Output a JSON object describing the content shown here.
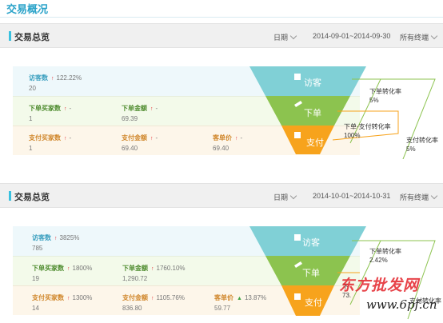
{
  "page_title": "交易概况",
  "panels": [
    {
      "title": "交易总览",
      "filters": {
        "date_label": "日期",
        "date_range": "2014-09-01~2014-09-30",
        "terminal": "所有终端"
      },
      "visitors": {
        "label": "访客数",
        "change": "122.22%",
        "value": "20"
      },
      "orders_buyers": {
        "label": "下单买家数",
        "change": "-",
        "value": "1"
      },
      "orders_amount": {
        "label": "下单金额",
        "change": "-",
        "value": "69.39"
      },
      "pay_buyers": {
        "label": "支付买家数",
        "change": "-",
        "value": "1"
      },
      "pay_amount": {
        "label": "支付金额",
        "change": "-",
        "value": "69.40"
      },
      "unit_price": {
        "label": "客单价",
        "change": "-",
        "value": "69.40"
      },
      "funnel": {
        "visit": "访客",
        "order": "下单",
        "pay": "支付"
      },
      "rates": {
        "order_conv_label": "下单转化率",
        "order_conv": "5%",
        "order_pay_label": "下单-支付转化率",
        "order_pay": "100%",
        "pay_conv_label": "支付转化率",
        "pay_conv": "5%"
      }
    },
    {
      "title": "交易总览",
      "filters": {
        "date_label": "日期",
        "date_range": "2014-10-01~2014-10-31",
        "terminal": "所有终端"
      },
      "visitors": {
        "label": "访客数",
        "change": "3825%",
        "value": "785"
      },
      "orders_buyers": {
        "label": "下单买家数",
        "change": "1800%",
        "value": "19"
      },
      "orders_amount": {
        "label": "下单金额",
        "change": "1760.10%",
        "value": "1,290.72"
      },
      "pay_buyers": {
        "label": "支付买家数",
        "change": "1300%",
        "value": "14"
      },
      "pay_amount": {
        "label": "支付金额",
        "change": "1105.76%",
        "value": "836.80"
      },
      "unit_price": {
        "label": "客单价",
        "change": "13.87%",
        "value": "59.77"
      },
      "funnel": {
        "visit": "访客",
        "order": "下单",
        "pay": "支付"
      },
      "rates": {
        "order_conv_label": "下单转化率",
        "order_conv": "2.42%",
        "order_pay_label": "下",
        "order_pay": "73.",
        "pay_conv_label": "支付转化率",
        "pay_conv": ""
      }
    }
  ],
  "watermark": {
    "line1": "东方批发网",
    "line2": "www.6pf.cn"
  },
  "colors": {
    "teal": "#80d0d6",
    "green": "#8cc34f",
    "orange": "#f7a31c",
    "accent": "#2aa3c9"
  }
}
